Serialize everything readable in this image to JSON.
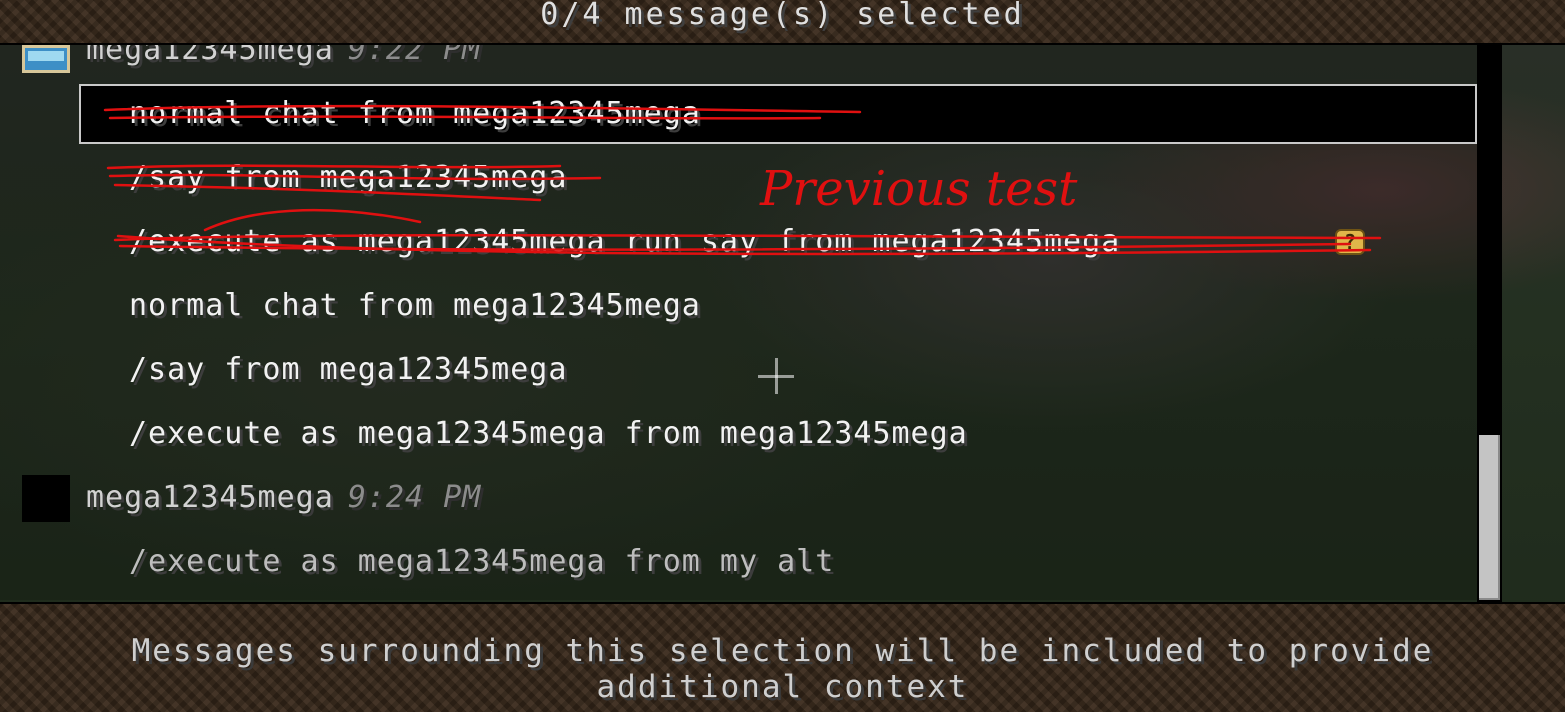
{
  "header": {
    "title": "0/4 message(s) selected"
  },
  "groups": [
    {
      "sender": "mega12345mega",
      "time": "9:22 PM",
      "messages": [
        "normal chat from mega12345mega",
        "/say from mega12345mega",
        "/execute as mega12345mega run say from mega12345mega",
        "normal chat from mega12345mega",
        "/say from mega12345mega",
        "/execute as mega12345mega from mega12345mega"
      ]
    },
    {
      "sender": "mega12345mega",
      "time": "9:24 PM",
      "messages": [
        "/execute as mega12345mega from my alt"
      ]
    }
  ],
  "help_badge": "?",
  "annotation": {
    "text": "Previous test",
    "color": "#e01010"
  },
  "footer": {
    "text": "Messages surrounding this selection will be included to provide additional context"
  }
}
